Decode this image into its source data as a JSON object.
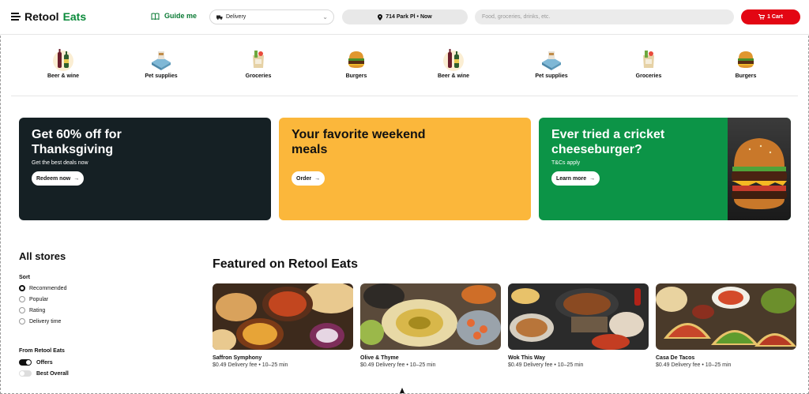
{
  "header": {
    "brand_part1": "Retool",
    "brand_part2": "Eats",
    "guide_label": "Guide me",
    "delivery_label": "Delivery",
    "address_label": "714 Park Pl • Now",
    "search_placeholder": "Food, groceries, drinks, etc.",
    "cart_label": "1 Cart",
    "brand_color": "#0a8a3a",
    "cart_color": "#e30613"
  },
  "categories": [
    {
      "label": "Beer & wine",
      "icon": "beer-wine-icon"
    },
    {
      "label": "Pet supplies",
      "icon": "pet-supplies-icon"
    },
    {
      "label": "Groceries",
      "icon": "groceries-icon"
    },
    {
      "label": "Burgers",
      "icon": "burger-icon"
    },
    {
      "label": "Beer & wine",
      "icon": "beer-wine-icon"
    },
    {
      "label": "Pet supplies",
      "icon": "pet-supplies-icon"
    },
    {
      "label": "Groceries",
      "icon": "groceries-icon"
    },
    {
      "label": "Burgers",
      "icon": "burger-icon"
    }
  ],
  "promos": [
    {
      "title": "Get 60% off for Thanksgiving",
      "subtitle": "Get the best deals now",
      "button": "Redeem now",
      "color": "#152024"
    },
    {
      "title": "Your favorite weekend meals",
      "subtitle": "",
      "button": "Order",
      "color": "#fbb73b"
    },
    {
      "title": "Ever tried a cricket cheeseburger?",
      "subtitle": "T&Cs apply",
      "button": "Learn more",
      "color": "#0c9447"
    }
  ],
  "sidebar": {
    "title": "All stores",
    "sort_label": "Sort",
    "sort_options": [
      "Recommended",
      "Popular",
      "Rating",
      "Delivery time"
    ],
    "selected_sort": "Recommended",
    "from_label": "From Retool Eats",
    "toggles": [
      {
        "label": "Offers",
        "on": true
      },
      {
        "label": "Best Overall",
        "on": false
      }
    ]
  },
  "featured": {
    "title": "Featured on Retool Eats",
    "stores": [
      {
        "name": "Saffron Symphony",
        "meta": "$0.49 Delivery fee • 10–25 min"
      },
      {
        "name": "Olive & Thyme",
        "meta": "$0.49 Delivery fee • 10–25 min"
      },
      {
        "name": "Wok This Way",
        "meta": "$0.49 Delivery fee • 10–25 min"
      },
      {
        "name": "Casa De Tacos",
        "meta": "$0.49 Delivery fee • 10–25 min"
      }
    ]
  }
}
